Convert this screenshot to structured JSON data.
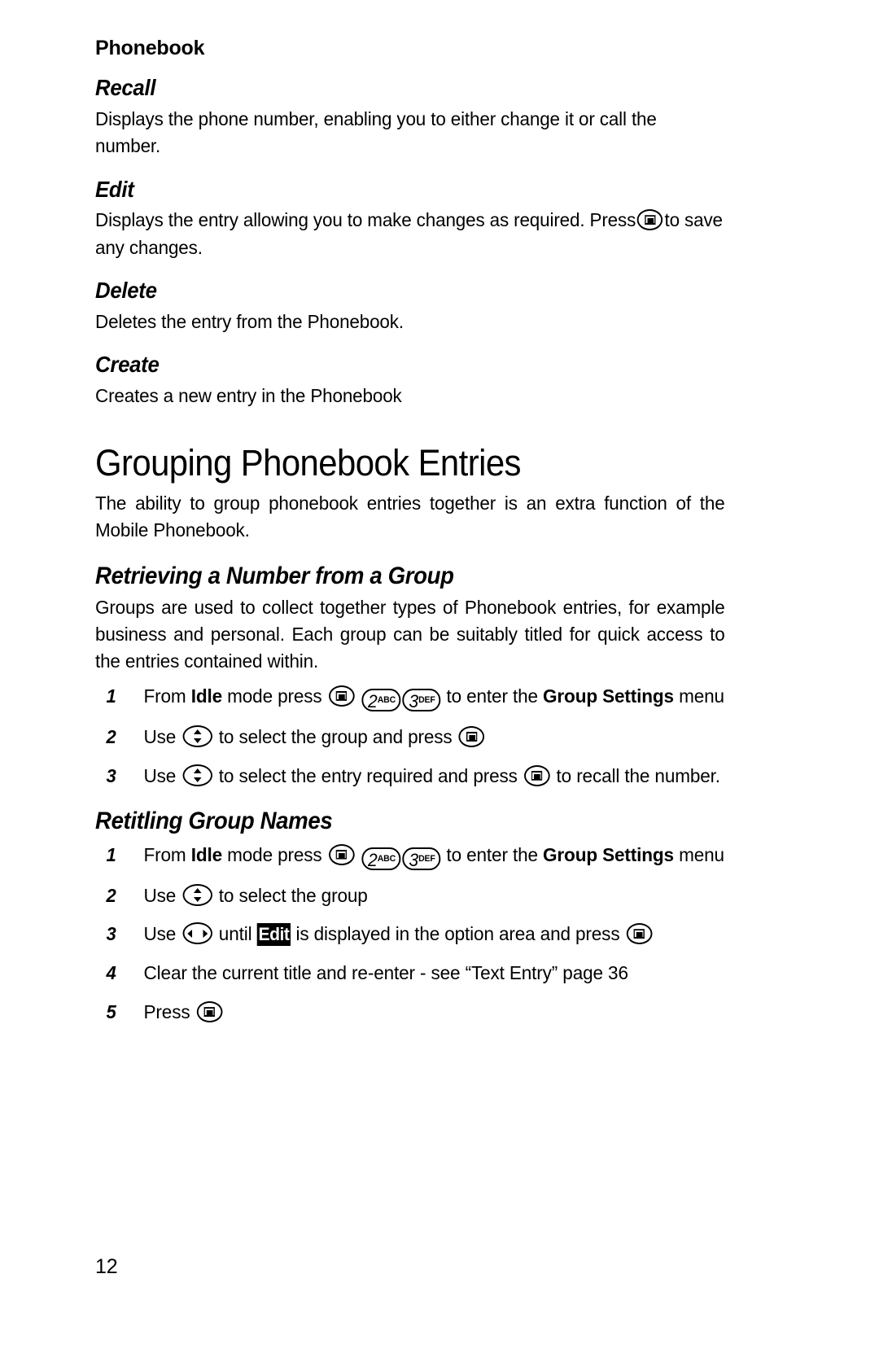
{
  "page": {
    "running_head": "Phonebook",
    "folio": "12"
  },
  "sections": [
    {
      "heading": "Recall",
      "body": "Displays the phone number, enabling you to either change it or call the number."
    },
    {
      "heading": "Edit",
      "body_pre": "Displays the entry allowing you to make changes as required. Press",
      "body_post": "to save any changes.",
      "key": "softkey-select-icon"
    },
    {
      "heading": "Delete",
      "body": "Deletes the entry from the Phonebook."
    },
    {
      "heading": "Create",
      "body": "Creates a new entry in the Phonebook"
    }
  ],
  "chapter": {
    "title": "Grouping Phonebook Entries",
    "intro": "The ability to group phonebook entries together is an extra function of the Mobile Phonebook."
  },
  "retrieving": {
    "heading": "Retrieving a Number from a Group",
    "intro": "Groups are used to collect together types of Phonebook entries, for example business and personal. Each group can be suitably titled for quick access to the entries contained within.",
    "steps": [
      {
        "num": "1",
        "parts": [
          {
            "t": "text",
            "v": "From "
          },
          {
            "t": "bold",
            "v": "Idle"
          },
          {
            "t": "text",
            "v": " mode press "
          },
          {
            "t": "key",
            "v": "softkey-select-icon"
          },
          {
            "t": "text",
            "v": " "
          },
          {
            "t": "numkey",
            "digit": "2",
            "letters": "ABC"
          },
          {
            "t": "numkey",
            "digit": "3",
            "letters": "DEF"
          },
          {
            "t": "text",
            "v": " to enter the "
          },
          {
            "t": "bold",
            "v": "Group Settings"
          },
          {
            "t": "text",
            "v": " menu"
          }
        ]
      },
      {
        "num": "2",
        "parts": [
          {
            "t": "text",
            "v": "Use "
          },
          {
            "t": "key",
            "v": "nav-updown-key-icon"
          },
          {
            "t": "text",
            "v": " to select the group and press "
          },
          {
            "t": "key",
            "v": "softkey-select-icon"
          }
        ]
      },
      {
        "num": "3",
        "parts": [
          {
            "t": "text",
            "v": "Use "
          },
          {
            "t": "key",
            "v": "nav-updown-key-icon"
          },
          {
            "t": "text",
            "v": " to select the entry required and press "
          },
          {
            "t": "key",
            "v": "softkey-select-icon"
          },
          {
            "t": "text",
            "v": " to recall the number."
          }
        ]
      }
    ]
  },
  "retitling": {
    "heading": "Retitling Group Names",
    "steps": [
      {
        "num": "1",
        "parts": [
          {
            "t": "text",
            "v": "From "
          },
          {
            "t": "bold",
            "v": "Idle"
          },
          {
            "t": "text",
            "v": " mode press "
          },
          {
            "t": "key",
            "v": "softkey-select-icon"
          },
          {
            "t": "text",
            "v": " "
          },
          {
            "t": "numkey",
            "digit": "2",
            "letters": "ABC"
          },
          {
            "t": "numkey",
            "digit": "3",
            "letters": "DEF"
          },
          {
            "t": "text",
            "v": " to enter the "
          },
          {
            "t": "bold",
            "v": "Group Settings"
          },
          {
            "t": "text",
            "v": " menu"
          }
        ]
      },
      {
        "num": "2",
        "parts": [
          {
            "t": "text",
            "v": "Use "
          },
          {
            "t": "key",
            "v": "nav-updown-key-icon"
          },
          {
            "t": "text",
            "v": " to select the group"
          }
        ]
      },
      {
        "num": "3",
        "parts": [
          {
            "t": "text",
            "v": "Use "
          },
          {
            "t": "key",
            "v": "nav-leftright-key-icon"
          },
          {
            "t": "text",
            "v": " until "
          },
          {
            "t": "inverse",
            "v": "Edit"
          },
          {
            "t": "text",
            "v": " is displayed in the option area and press "
          },
          {
            "t": "key",
            "v": "softkey-select-icon"
          }
        ]
      },
      {
        "num": "4",
        "parts": [
          {
            "t": "text",
            "v": "Clear the current title and re-enter - see “Text Entry” page 36"
          }
        ]
      },
      {
        "num": "5",
        "parts": [
          {
            "t": "text",
            "v": "Press "
          },
          {
            "t": "key",
            "v": "softkey-select-icon"
          }
        ]
      }
    ]
  }
}
